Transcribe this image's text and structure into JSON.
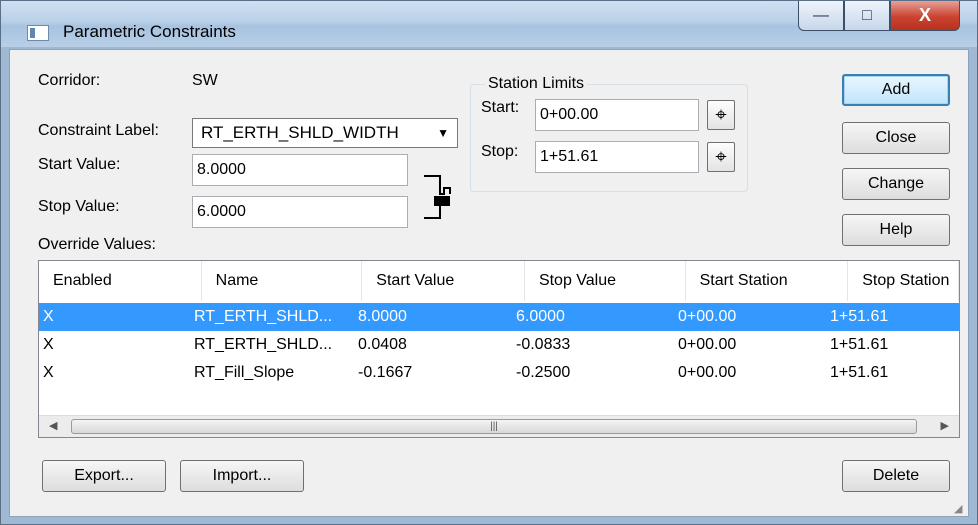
{
  "window": {
    "title": "Parametric Constraints",
    "minimize": "—",
    "maximize": "□",
    "close": "X"
  },
  "corridor": {
    "label": "Corridor:",
    "value": "SW"
  },
  "constraint_label": {
    "label": "Constraint Label:",
    "value": "RT_ERTH_SHLD_WIDTH"
  },
  "start_value": {
    "label": "Start Value:",
    "value": "8.0000"
  },
  "stop_value": {
    "label": "Stop Value:",
    "value": "6.0000"
  },
  "station_limits": {
    "title": "Station Limits",
    "start_label": "Start:",
    "start_value": "0+00.00",
    "stop_label": "Stop:",
    "stop_value": "1+51.61"
  },
  "buttons": {
    "add": "Add",
    "close": "Close",
    "change": "Change",
    "help": "Help",
    "export": "Export...",
    "import": "Import...",
    "delete": "Delete"
  },
  "override": {
    "label": "Override Values:",
    "columns": [
      "Enabled",
      "Name",
      "Start Value",
      "Stop Value",
      "Start Station",
      "Stop Station"
    ],
    "rows": [
      [
        "X",
        "RT_ERTH_SHLD...",
        "8.0000",
        "6.0000",
        "0+00.00",
        "1+51.61"
      ],
      [
        "X",
        "RT_ERTH_SHLD...",
        "0.0408",
        "-0.0833",
        "0+00.00",
        "1+51.61"
      ],
      [
        "X",
        "RT_Fill_Slope",
        "-0.1667",
        "-0.2500",
        "0+00.00",
        "1+51.61"
      ]
    ],
    "selected_row": 0
  },
  "colors": {
    "selection": "#3399ff",
    "title_gradient": "#b9d0e8",
    "close_button": "#c9432f"
  }
}
